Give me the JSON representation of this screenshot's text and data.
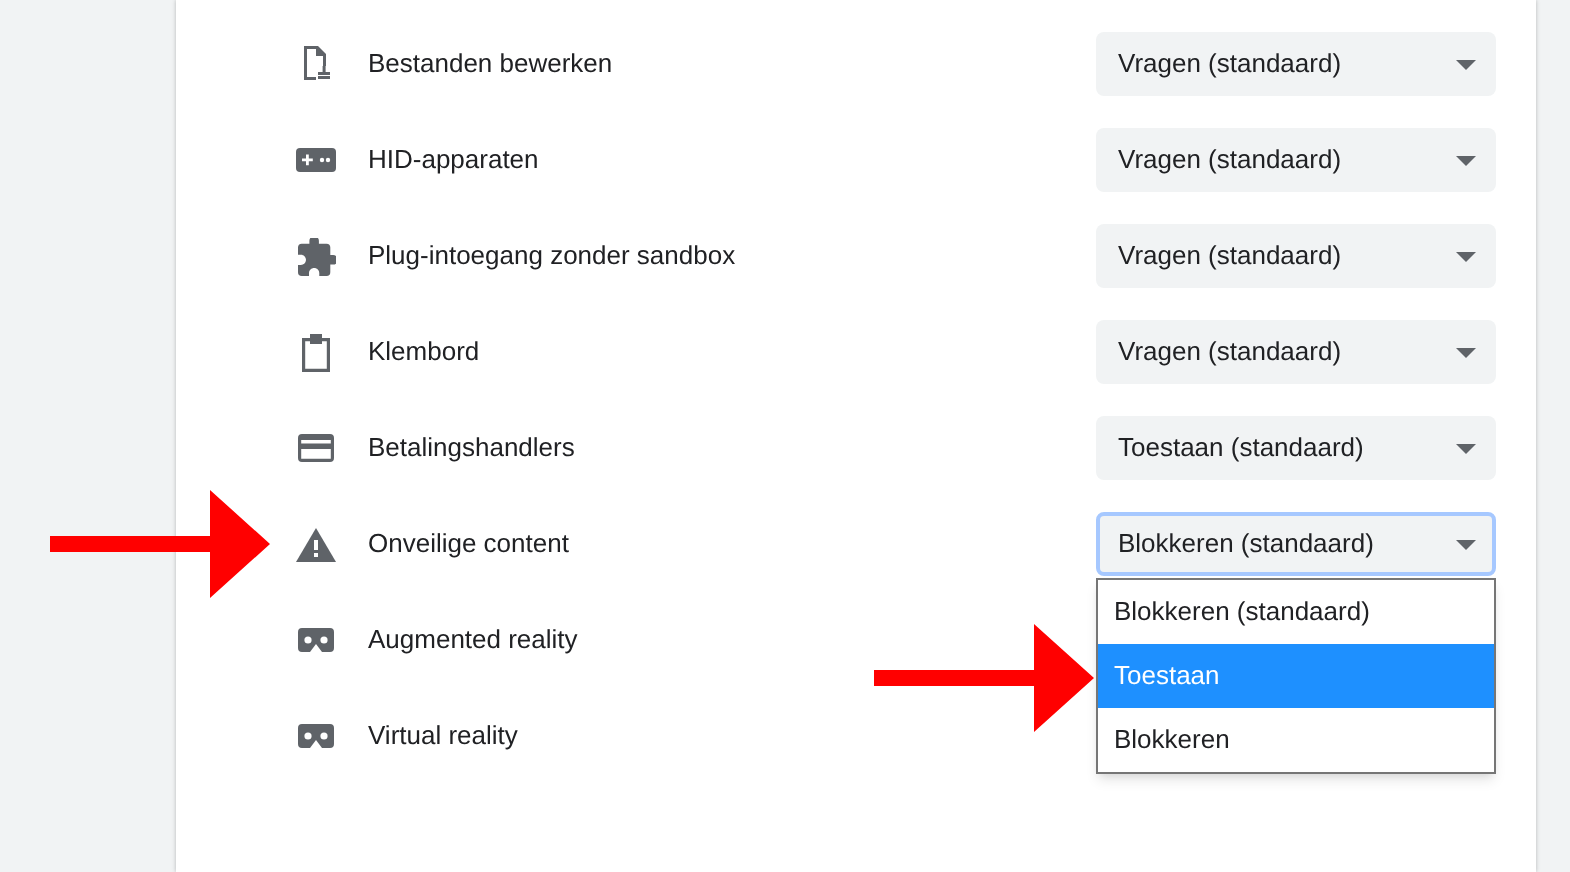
{
  "settings": [
    {
      "label": "Bestanden bewerken",
      "value": "Vragen (standaard)",
      "open": false
    },
    {
      "label": "HID-apparaten",
      "value": "Vragen (standaard)",
      "open": false
    },
    {
      "label": "Plug-intoegang zonder sandbox",
      "value": "Vragen (standaard)",
      "open": false
    },
    {
      "label": "Klembord",
      "value": "Vragen (standaard)",
      "open": false
    },
    {
      "label": "Betalingshandlers",
      "value": "Toestaan (standaard)",
      "open": false
    },
    {
      "label": "Onveilige content",
      "value": "Blokkeren (standaard)",
      "open": true
    },
    {
      "label": "Augmented reality"
    },
    {
      "label": "Virtual reality"
    }
  ],
  "dropdown": {
    "options": [
      {
        "label": "Blokkeren (standaard)",
        "selected": false
      },
      {
        "label": "Toestaan",
        "selected": true
      },
      {
        "label": "Blokkeren",
        "selected": false
      }
    ]
  }
}
